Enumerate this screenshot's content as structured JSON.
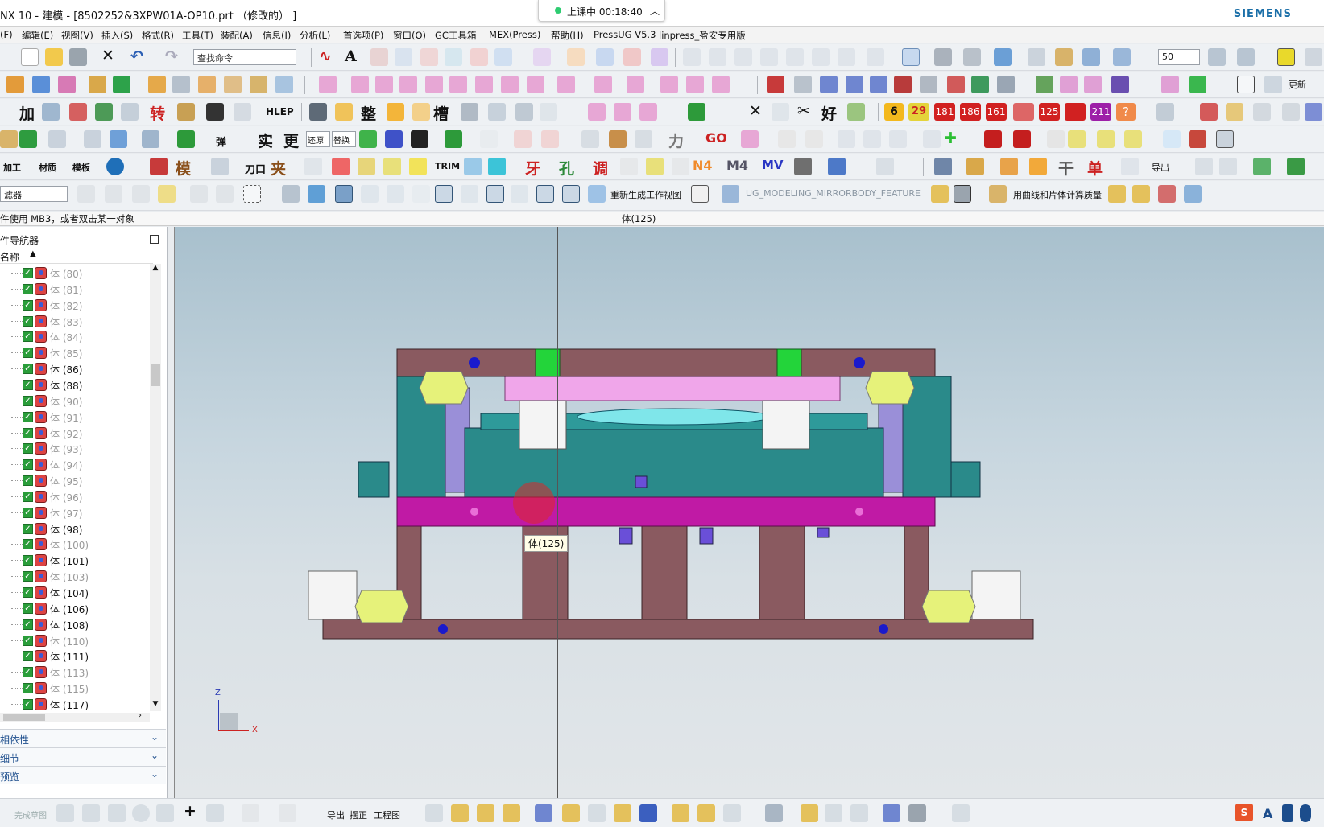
{
  "window": {
    "title": "NX 10 - 建模 - [8502252&3XPW01A-OP10.prt （修改的） ]",
    "brand": "SIEMENS"
  },
  "recording": {
    "label": "上课中 00:18:40"
  },
  "menu": [
    "(F)",
    "编辑(E)",
    "视图(V)",
    "插入(S)",
    "格式(R)",
    "工具(T)",
    "装配(A)",
    "信息(I)",
    "分析(L)",
    "首选项(P)",
    "窗口(O)",
    "GC工具箱",
    "MEX(Press)",
    "帮助(H)",
    "PressUG V5.3",
    "linpress_盈安专用版"
  ],
  "toolbar": {
    "search_placeholder": "查找命令",
    "zoom_value": "50",
    "filter_label": "滤器",
    "regen_view": "重新生成工作视图",
    "mirror_feature": "UG_MODELING_MIRRORBODY_FEATURE",
    "mass_calc": "用曲线和片体计算质量",
    "help_label": "HLEP",
    "trim_label": "TRIM",
    "numbered_buttons": [
      "6",
      "29",
      "181",
      "186",
      "161",
      "125",
      "211"
    ],
    "other_labels": [
      "整",
      "槽",
      "好",
      "模",
      "夹",
      "N4",
      "M4",
      "MV",
      "GO",
      "力",
      "单",
      "更新",
      "替换",
      "还原",
      "加工",
      "材质",
      "模板",
      "导出"
    ],
    "numbered_colors": [
      "#f3b81d",
      "#e4d33a",
      "#d12121",
      "#d12121",
      "#d12121",
      "#d12121",
      "#d12121"
    ]
  },
  "prompt": {
    "left": "件使用 MB3，或者双击某一对象",
    "center": "体(125)"
  },
  "navigator": {
    "title": "件导航器",
    "column_header": "名称",
    "rows": [
      {
        "label": "体 (80)",
        "dim": true
      },
      {
        "label": "体 (81)",
        "dim": true
      },
      {
        "label": "体 (82)",
        "dim": true
      },
      {
        "label": "体 (83)",
        "dim": true
      },
      {
        "label": "体 (84)",
        "dim": true
      },
      {
        "label": "体 (85)",
        "dim": true
      },
      {
        "label": "体 (86)",
        "dim": false
      },
      {
        "label": "体 (88)",
        "dim": false
      },
      {
        "label": "体 (90)",
        "dim": true
      },
      {
        "label": "体 (91)",
        "dim": true
      },
      {
        "label": "体 (92)",
        "dim": true
      },
      {
        "label": "体 (93)",
        "dim": true
      },
      {
        "label": "体 (94)",
        "dim": true
      },
      {
        "label": "体 (95)",
        "dim": true
      },
      {
        "label": "体 (96)",
        "dim": true
      },
      {
        "label": "体 (97)",
        "dim": true
      },
      {
        "label": "体 (98)",
        "dim": false
      },
      {
        "label": "体 (100)",
        "dim": true
      },
      {
        "label": "体 (101)",
        "dim": false
      },
      {
        "label": "体 (103)",
        "dim": true
      },
      {
        "label": "体 (104)",
        "dim": false
      },
      {
        "label": "体 (106)",
        "dim": false
      },
      {
        "label": "体 (108)",
        "dim": false
      },
      {
        "label": "体 (110)",
        "dim": true
      },
      {
        "label": "体 (111)",
        "dim": false
      },
      {
        "label": "体 (113)",
        "dim": true
      },
      {
        "label": "体 (115)",
        "dim": true
      },
      {
        "label": "体 (117)",
        "dim": false
      }
    ],
    "sections": [
      "相依性",
      "细节",
      "预览"
    ]
  },
  "viewport": {
    "tooltip": "体(125)",
    "axis_z": "Z",
    "axis_x": "X"
  },
  "bottombar": {
    "labels": [
      "完成草图",
      "导出",
      "摆正",
      "工程图"
    ]
  },
  "colors": {
    "plate_brown": "#8a5a60",
    "plate_magenta": "#c01aa5",
    "plate_pink": "#f0a6ea",
    "die_teal": "#2a8a8a",
    "spring_yellow": "#e6f27a",
    "guide_green": "#23d43a"
  }
}
